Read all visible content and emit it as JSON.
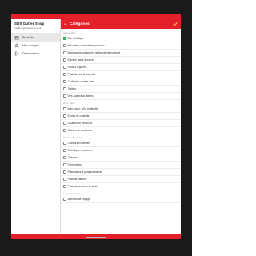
{
  "colors": {
    "accent": "#e4202a",
    "check": "#2bb24c"
  },
  "sidebar": {
    "shop_name": "SDS Gutter Shop",
    "shop_email": "mailbox@sdsgutter.co.uk",
    "items": [
      {
        "label": "Products",
        "icon": "box-icon",
        "active": true
      },
      {
        "label": "Mon Compte",
        "icon": "user-icon",
        "active": false
      },
      {
        "label": "Déconnexion",
        "icon": "logout-icon",
        "active": false
      }
    ]
  },
  "header": {
    "back": "←",
    "title": "Catégories"
  },
  "list": [
    {
      "type": "section",
      "label": "Alimentation"
    },
    {
      "type": "row",
      "label": "Bio, diététique",
      "checked": true
    },
    {
      "type": "row",
      "label": "Boucherie, charcuterie, poissons",
      "checked": false
    },
    {
      "type": "row",
      "label": "Boulangerie, pâtisserie, pâtisserie/viennoiserie",
      "checked": false
    },
    {
      "type": "row",
      "label": "Épicerie salée & sucrée",
      "checked": false
    },
    {
      "type": "row",
      "label": "Fruits & légumes",
      "checked": false
    },
    {
      "type": "row",
      "label": "Produits frais & surgelés",
      "checked": false
    },
    {
      "type": "row",
      "label": "Confiserie, caviste, thés",
      "checked": false
    },
    {
      "type": "row",
      "label": "Traiteur",
      "checked": false
    },
    {
      "type": "row",
      "label": "Vins, spiritueux, bières",
      "checked": false
    },
    {
      "type": "section",
      "label": "Auto / Moto"
    },
    {
      "type": "row",
      "label": "Auto, moto, vélo, trottinette",
      "checked": false
    },
    {
      "type": "row",
      "label": "Écoles de conduite",
      "checked": false
    },
    {
      "type": "row",
      "label": "Location de véhicules",
      "checked": false
    },
    {
      "type": "row",
      "label": "Stations de carburant",
      "checked": false
    },
    {
      "type": "section",
      "label": "Beauté / Bien-être"
    },
    {
      "type": "row",
      "label": "Coiffeurs et barbiers",
      "checked": false
    },
    {
      "type": "row",
      "label": "Esthétique, manucure",
      "checked": false
    },
    {
      "type": "row",
      "label": "Opticiens",
      "checked": false
    },
    {
      "type": "row",
      "label": "Parfumeries",
      "checked": false
    },
    {
      "type": "row",
      "label": "Pharmacies & parapharmacies",
      "checked": false
    },
    {
      "type": "row",
      "label": "Produits naturels",
      "checked": false
    },
    {
      "type": "row",
      "label": "Professionnels de la santé",
      "checked": false
    },
    {
      "type": "section",
      "label": "Loisirs / Voyages"
    },
    {
      "type": "row",
      "label": "Agences de voyage",
      "checked": false
    }
  ]
}
